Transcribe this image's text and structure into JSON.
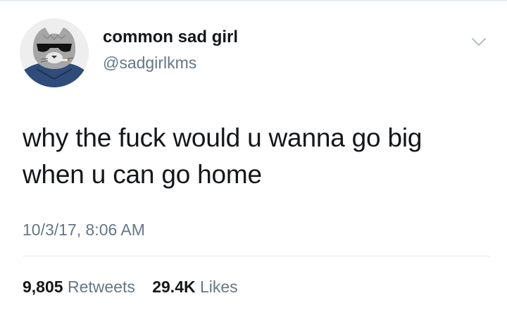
{
  "tweet": {
    "author": {
      "display_name": "common sad girl",
      "handle": "@sadgirlkms",
      "avatar_icon": "cat-with-sunglasses-avatar"
    },
    "menu_icon": "chevron-down-icon",
    "text": "why the fuck would u wanna go big\nwhen u can go home",
    "timestamp": "10/3/17, 8:06 AM",
    "stats": {
      "retweets": {
        "count": "9,805",
        "label": "Retweets"
      },
      "likes": {
        "count": "29.4K",
        "label": "Likes"
      }
    }
  },
  "colors": {
    "primary_text": "#14171a",
    "secondary_text": "#657786",
    "divider": "#e6ecf0",
    "background": "#ffffff"
  }
}
